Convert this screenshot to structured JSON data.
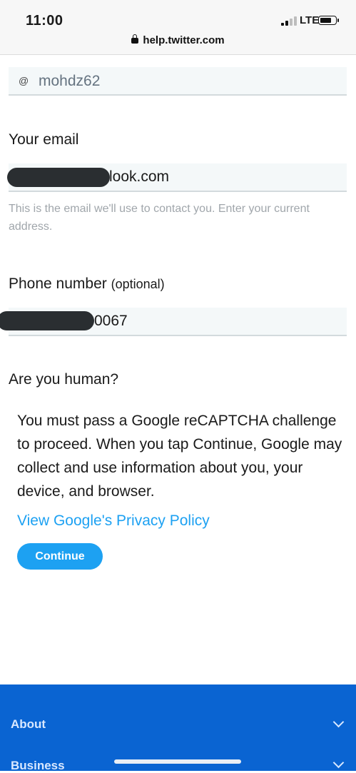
{
  "status_bar": {
    "time": "11:00",
    "network": "LTE",
    "url": "help.twitter.com"
  },
  "form": {
    "username": {
      "at_symbol": "@",
      "value": "mohdz62"
    },
    "email": {
      "label": "Your email",
      "value_visible": "look.com",
      "hint": "This is the email we'll use to contact you. Enter your current address."
    },
    "phone": {
      "label": "Phone number",
      "optional": "(optional)",
      "value_visible": "0067"
    }
  },
  "captcha": {
    "heading": "Are you human?",
    "text": "You must pass a Google reCAPTCHA challenge to proceed. When you tap Continue, Google may collect and use information about you, your device, and browser.",
    "privacy_link": "View Google's Privacy Policy",
    "continue_label": "Continue"
  },
  "footer": {
    "items": [
      {
        "label": "About",
        "icon": "chevron-down-icon"
      },
      {
        "label": "Business",
        "icon": "chevron-down-icon"
      }
    ],
    "background_color": "#0a64d2"
  },
  "colors": {
    "accent": "#1da1f2"
  }
}
